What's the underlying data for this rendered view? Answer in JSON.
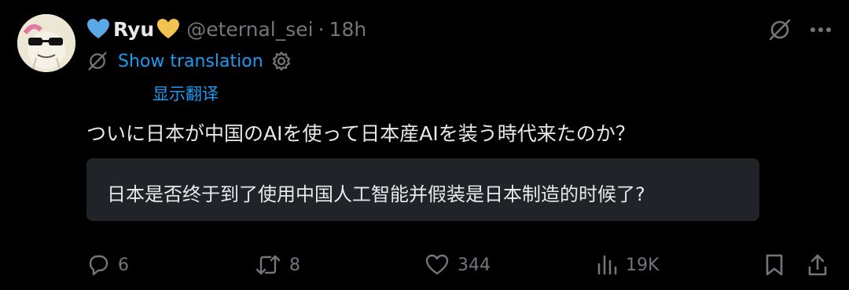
{
  "author": {
    "name": "Ryu",
    "handle": "@eternal_sei",
    "separator": "·",
    "time": "18h"
  },
  "translation_link": {
    "label": "Show translation",
    "translated_label": "显示翻译"
  },
  "tweet": {
    "text": "ついに日本が中国のAIを使って日本産AIを装う時代来たのか？",
    "translation": "日本是否终于到了使用中国人工智能并假装是日本制造的时候了?"
  },
  "actions": {
    "replies": "6",
    "reposts": "8",
    "likes": "344",
    "views": "19K"
  },
  "colors": {
    "background": "#000000",
    "text": "#e7e9ea",
    "muted": "#71767b",
    "link": "#1d9bf0",
    "translation_box": "#202327",
    "heart_blue": "#5aa8e6",
    "heart_gold": "#f2c34e"
  },
  "icons": {
    "avatar": "avatar",
    "heart_left": "blue-heart-icon",
    "heart_right": "yellow-heart-icon",
    "grok": "grok-icon",
    "more": "more-icon",
    "settings": "gear-icon",
    "reply": "reply-icon",
    "repost": "repost-icon",
    "like": "like-icon",
    "views": "views-icon",
    "bookmark": "bookmark-icon",
    "share": "share-icon"
  }
}
